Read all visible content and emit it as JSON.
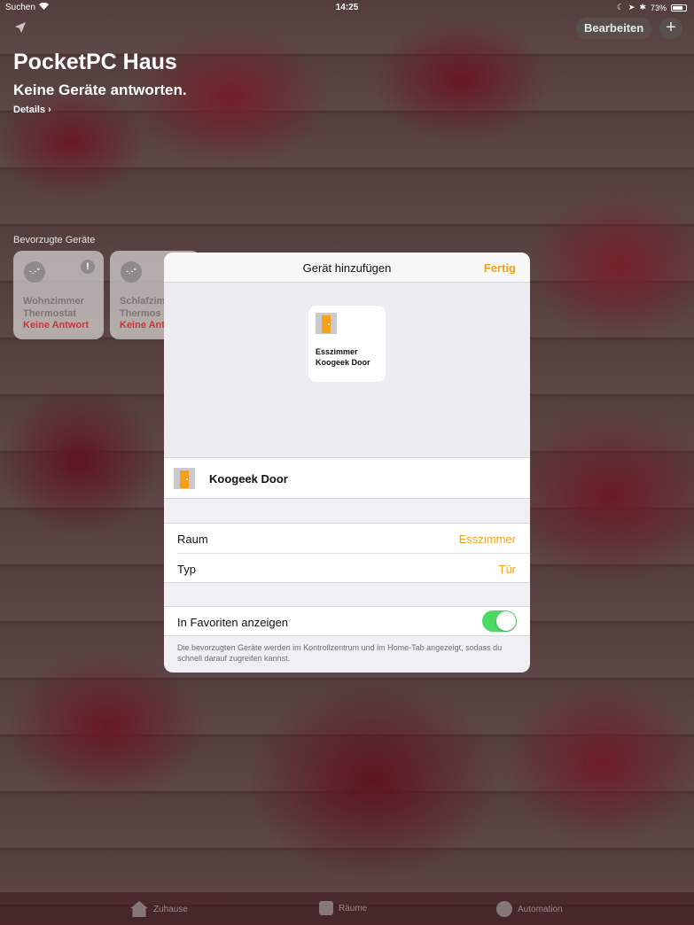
{
  "statusbar": {
    "carrier": "Suchen",
    "time": "14:25",
    "battery": "73%"
  },
  "topbar": {
    "edit_label": "Bearbeiten",
    "add_label": "+"
  },
  "home": {
    "title": "PocketPC Haus",
    "subtitle": "Keine Geräte antworten.",
    "details_label": "Details ›",
    "favorites_header": "Bevorzugte Geräte"
  },
  "favorites": [
    {
      "name": "Wohnzimmer Thermostat",
      "status": "Keine Antwort",
      "icon": "thermostat-icon"
    },
    {
      "name": "Schlafzim Thermos",
      "status": "Keine Ant",
      "icon": "thermostat-icon"
    }
  ],
  "modal": {
    "title": "Gerät hinzufügen",
    "done_label": "Fertig",
    "preview_line1": "Esszimmer",
    "preview_line2": "Koogeek Door",
    "device_name": "Koogeek Door",
    "room_label": "Raum",
    "room_value": "Esszimmer",
    "type_label": "Typ",
    "type_value": "Tür",
    "favorites_label": "In Favoriten anzeigen",
    "favorites_enabled": true,
    "favorites_footnote": "Die bevorzugten Geräte werden im Kontrollzentrum und im Home-Tab angezeigt, sodass du schnell darauf zugreifen kannst."
  },
  "tabs": {
    "home": "Zuhause",
    "rooms": "Räume",
    "automation": "Automation"
  },
  "colors": {
    "accent": "#f2a31a",
    "toggle_on": "#4cd964",
    "door": "#f4a019",
    "alert_text": "#c8373a"
  }
}
